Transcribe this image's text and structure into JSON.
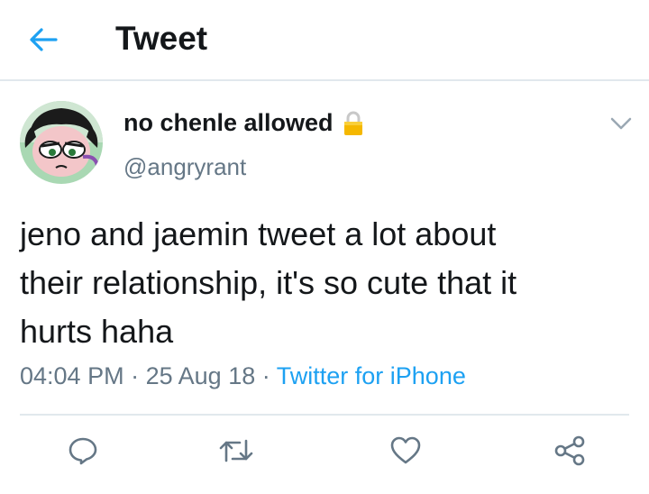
{
  "header": {
    "title": "Tweet"
  },
  "tweet": {
    "display_name": "no chenle allowed",
    "handle": "@angryrant",
    "text": "jeno and jaemin tweet a lot about\ntheir relationship, it's so cute that it\nhurts haha",
    "time": "04:04 PM",
    "separator": "·",
    "date": "25 Aug 18",
    "source": "Twitter for iPhone"
  },
  "icons": {
    "back": "arrow-left-icon",
    "lock": "lock-icon",
    "caret": "chevron-down-icon",
    "reply": "reply-icon",
    "retweet": "retweet-icon",
    "like": "heart-icon",
    "share": "share-icon"
  },
  "colors": {
    "accent": "#1da1f2",
    "text": "#14171a",
    "secondary": "#657786",
    "divider": "#e1e8ed",
    "lock": "#f5b800"
  }
}
